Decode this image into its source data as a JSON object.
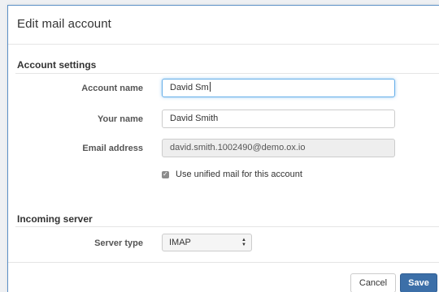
{
  "dialog": {
    "title": "Edit mail account"
  },
  "account_settings": {
    "heading": "Account settings",
    "account_name": {
      "label": "Account name",
      "value": "David Sm"
    },
    "your_name": {
      "label": "Your name",
      "value": "David Smith"
    },
    "email_address": {
      "label": "Email address",
      "value": "david.smith.1002490@demo.ox.io"
    },
    "unified_mail": {
      "label": "Use unified mail for this account",
      "checked": true
    }
  },
  "incoming_server": {
    "heading": "Incoming server",
    "server_type": {
      "label": "Server type",
      "value": "IMAP"
    }
  },
  "footer": {
    "cancel_label": "Cancel",
    "save_label": "Save"
  },
  "colors": {
    "accent": "#3c6fa8",
    "focus_border": "#66afe9",
    "dialog_border": "#5a8fc6"
  }
}
